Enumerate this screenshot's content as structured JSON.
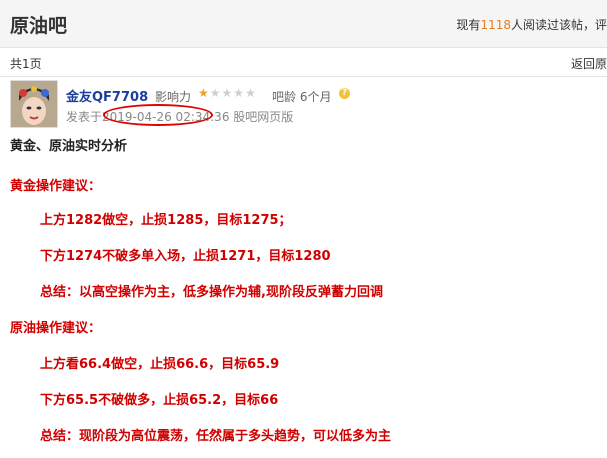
{
  "header": {
    "forum_title": "原油吧",
    "reading_prefix": "现有",
    "reading_count": "1118",
    "reading_suffix": "人阅读过该帖，评"
  },
  "subbar": {
    "page_count": "共1页",
    "back_link": "返回原"
  },
  "post": {
    "username": "金友QF7708",
    "influence_label": "影响力",
    "influence_stars": 1,
    "influence_max": 5,
    "age": "吧龄 6个月",
    "posted_at": "发表于2019-04-26 02:34:36 股吧网页版",
    "title": "黄金、原油实时分析",
    "lines": [
      "黄金操作建议：",
      "上方1282做空，止损1285，目标1275；",
      "下方1274不破多单入场，止损1271，目标1280",
      "总结：以高空操作为主，低多操作为辅,现阶段反弹蓄力回调",
      "原油操作建议：",
      "上方看66.4做空，止损66.6，目标65.9",
      "下方65.5不破做多，止损65.2，目标66",
      "总结：现阶段为高位震荡，任然属于多头趋势，可以低多为主"
    ]
  }
}
